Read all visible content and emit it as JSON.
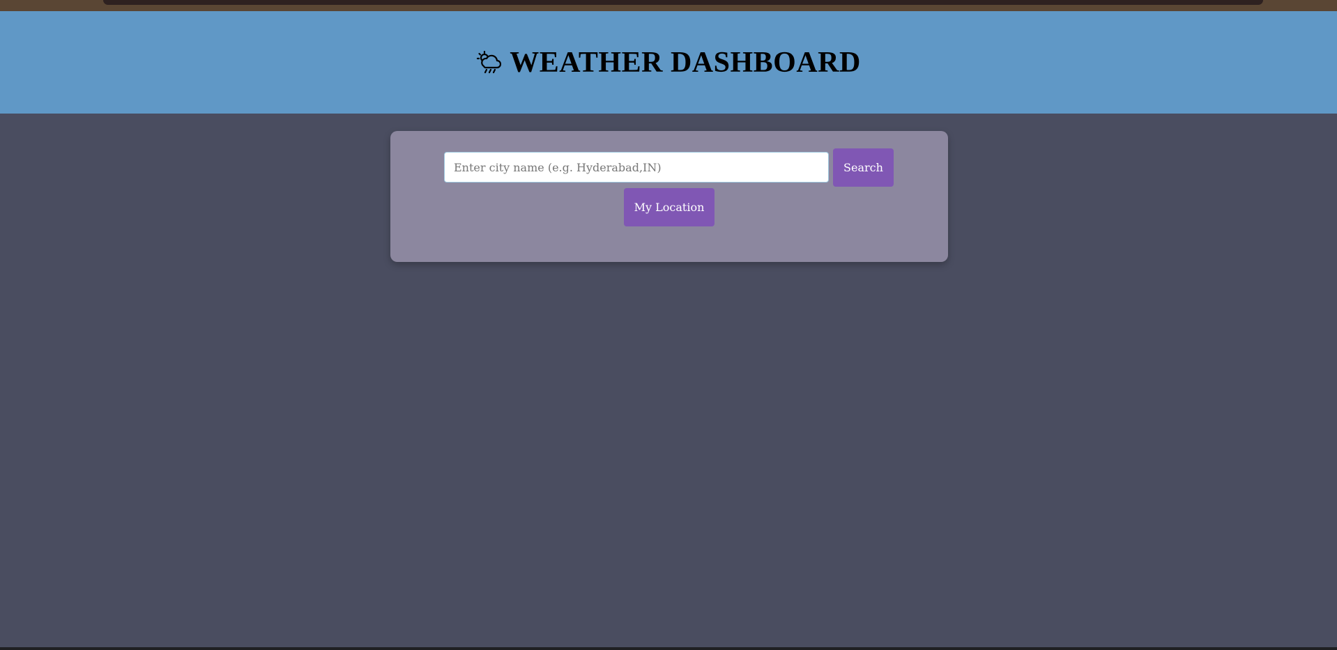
{
  "header": {
    "title": "WEATHER DASHBOARD",
    "icon": "sun-behind-rain-cloud-icon"
  },
  "search": {
    "placeholder": "Enter city name (e.g. Hyderabad,IN)",
    "value": "",
    "search_label": "Search",
    "location_label": "My Location"
  },
  "colors": {
    "header_bg": "#6098c6",
    "page_bg": "#4a4d60",
    "panel_bg": "#8c879f",
    "button_bg": "#8057b4"
  }
}
